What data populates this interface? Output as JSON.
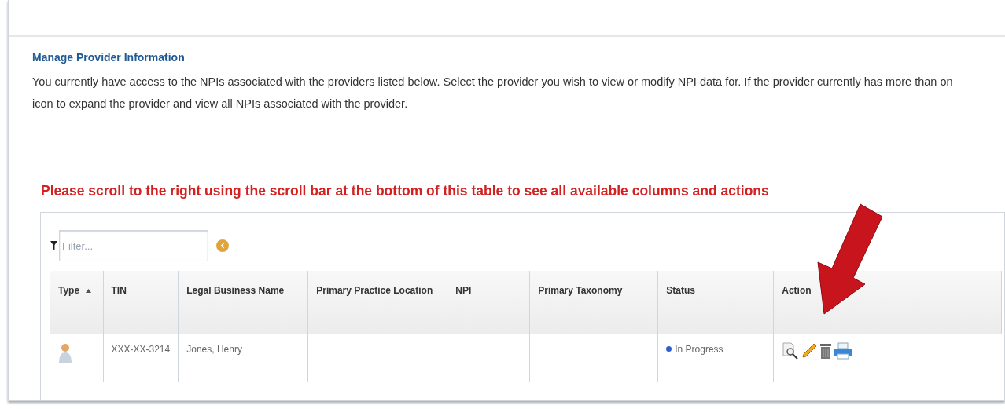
{
  "heading": "Manage Provider Information",
  "description_lines": [
    "You currently have access to the NPIs associated with the providers listed below. Select the provider you wish to view or modify NPI data for. If the provider currently has more than on",
    "icon to expand the provider and view all NPIs associated with the provider."
  ],
  "notice": "Please scroll to the right using the scroll bar at the bottom of this table to see all available columns and actions",
  "filter": {
    "placeholder": "Filter..."
  },
  "table": {
    "columns": [
      {
        "label": "Type",
        "sorted": true
      },
      {
        "label": "TIN"
      },
      {
        "label": "Legal Business Name"
      },
      {
        "label": "Primary Practice Location"
      },
      {
        "label": "NPI"
      },
      {
        "label": "Primary Taxonomy"
      },
      {
        "label": "Status"
      },
      {
        "label": "Action"
      }
    ],
    "rows": [
      {
        "kind": "individual",
        "tin": "XXX-XX-3214",
        "legal_business_name": "Jones, Henry",
        "status": {
          "label": "In Progress",
          "color": "#2f5fd0"
        },
        "actions": [
          {
            "kind": "view"
          },
          {
            "kind": "edit"
          },
          {
            "kind": "delete"
          },
          {
            "kind": "print"
          }
        ]
      }
    ]
  }
}
